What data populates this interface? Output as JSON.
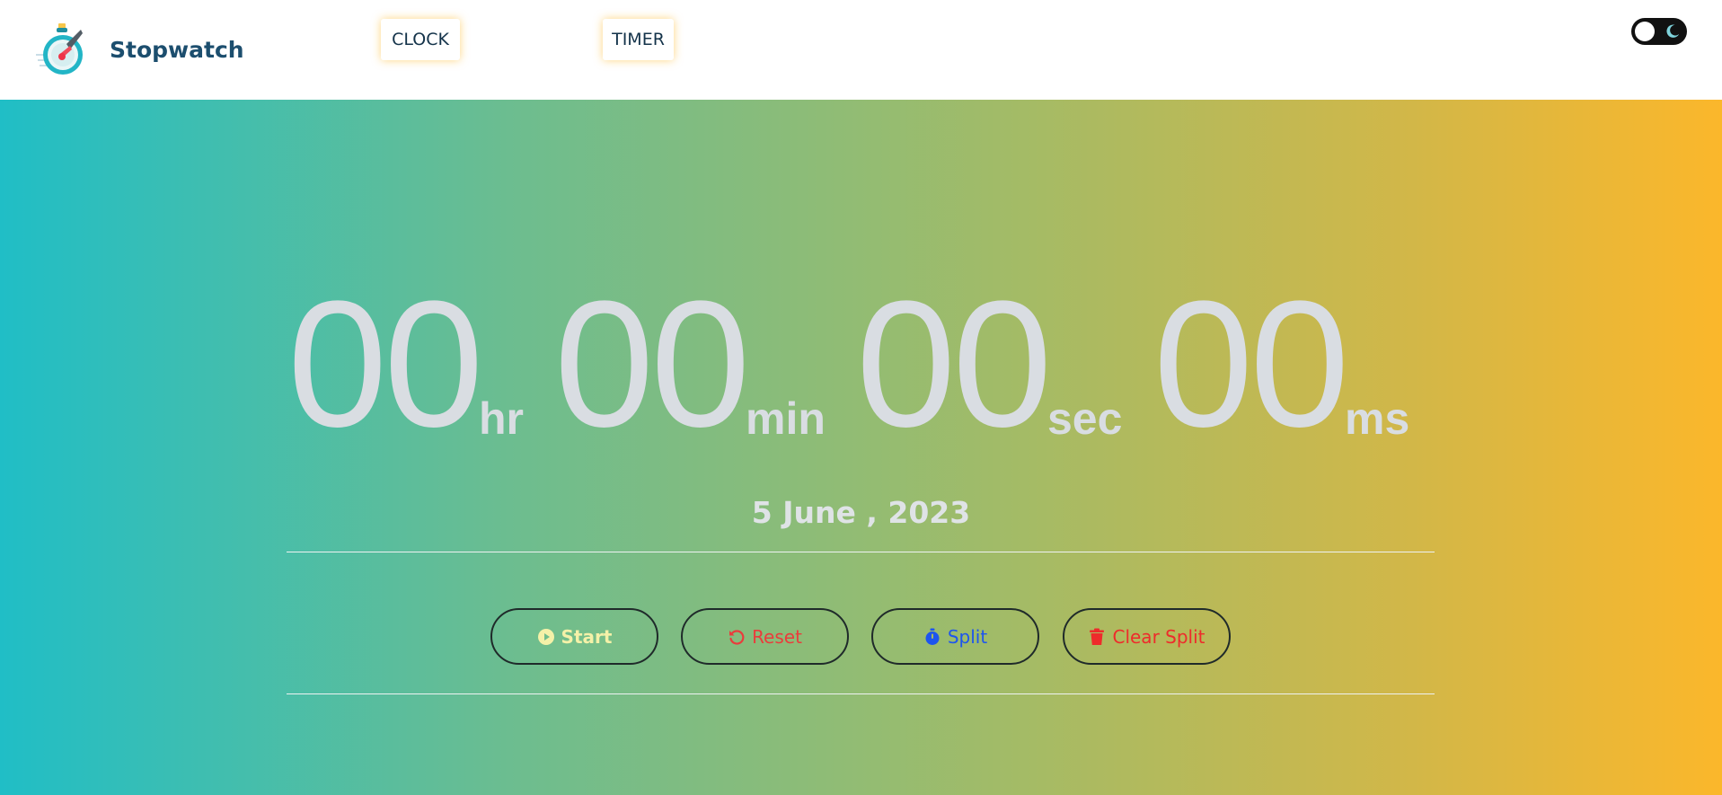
{
  "header": {
    "brand_name": "Stopwatch",
    "logo_icon": "stopwatch-rocket-logo",
    "nav": {
      "clock_label": "CLOCK",
      "timer_label": "TIMER"
    },
    "theme_toggle": {
      "state": "light",
      "icon": "moon-icon"
    }
  },
  "stopwatch": {
    "hours": "00",
    "hours_unit": "hr",
    "minutes": "00",
    "minutes_unit": "min",
    "seconds": "00",
    "seconds_unit": "sec",
    "milliseconds": "00",
    "milliseconds_unit": "ms"
  },
  "date_text": "5 June , 2023",
  "controls": {
    "start_label": "Start",
    "start_icon": "play-circle-icon",
    "reset_label": "Reset",
    "reset_icon": "rotate-left-icon",
    "split_label": "Split",
    "split_icon": "stopwatch-icon",
    "clear_split_label": "Clear Split",
    "clear_split_icon": "trash-icon"
  },
  "colors": {
    "gradient_start": "#20bec6",
    "gradient_end": "#fbb72b",
    "brand_text": "#1c4e6e",
    "digits": "#d9dde2",
    "start": "#f4f1a8",
    "reset": "#ea3c3c",
    "split": "#1d55ee",
    "clear_split": "#ee2b2b"
  }
}
